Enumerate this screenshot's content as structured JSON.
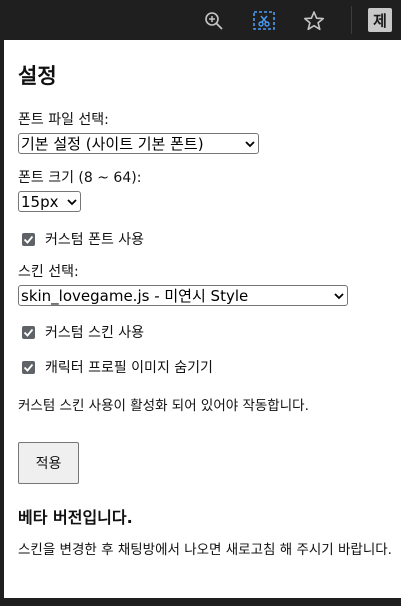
{
  "browser": {
    "extension_label": "제",
    "icons": [
      "zoom-in-icon",
      "screenshot-cut-icon",
      "bookmark-star-icon"
    ]
  },
  "popup": {
    "title": "설정",
    "font_file": {
      "label": "폰트 파일 선택:",
      "selected": "기본 설정 (사이트 기본 폰트)"
    },
    "font_size": {
      "label": "폰트 크기 (8 ~ 64):",
      "selected": "15px"
    },
    "custom_font_checkbox": {
      "label": "커스텀 폰트 사용",
      "checked": true
    },
    "skin": {
      "label": "스킨 선택:",
      "selected": "skin_lovegame.js - 미연시 Style"
    },
    "custom_skin_checkbox": {
      "label": "커스텀 스킨 사용",
      "checked": true
    },
    "hide_profile_checkbox": {
      "label": "캐릭터 프로필 이미지 숨기기",
      "checked": true
    },
    "note": "커스텀 스킨 사용이 활성화 되어 있어야 작동합니다.",
    "apply_button": "적용",
    "beta_heading": "베타 버전입니다.",
    "beta_text": "스킨을 변경한 후 채팅방에서 나오면 새로고침 해 주시기 바랍니다."
  },
  "colors": {
    "toolbar_bg": "#1f1f1f",
    "popup_bg": "#ffffff",
    "accent_icon": "#4a9cf5",
    "checkbox": "#5f6368"
  }
}
